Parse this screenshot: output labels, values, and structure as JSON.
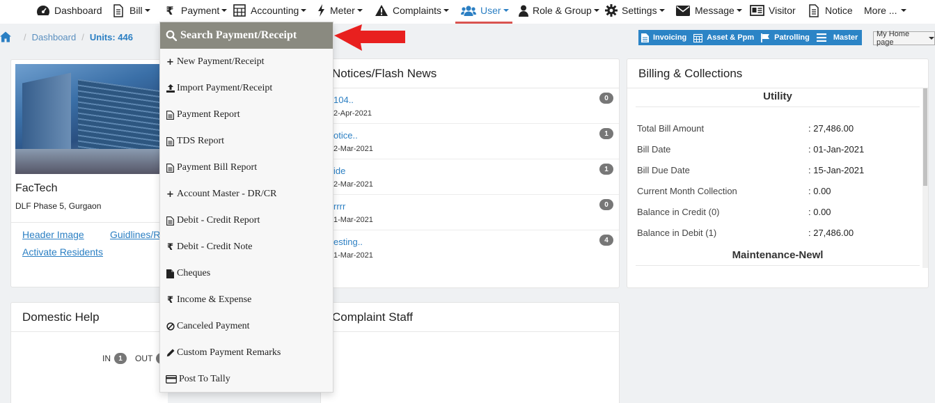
{
  "nav": {
    "items": [
      {
        "label": "Dashboard",
        "icon": "dashboard-icon",
        "caret": false
      },
      {
        "label": "Bill",
        "icon": "bill-icon",
        "caret": true
      },
      {
        "label": "Payment",
        "icon": "rupee-icon",
        "caret": true
      },
      {
        "label": "Accounting",
        "icon": "calculator-icon",
        "caret": true
      },
      {
        "label": "Meter",
        "icon": "bolt-icon",
        "caret": true
      },
      {
        "label": "Complaints",
        "icon": "warning-icon",
        "caret": true
      },
      {
        "label": "User",
        "icon": "users-icon",
        "caret": true,
        "active": true
      },
      {
        "label": "Role & Group",
        "icon": "user-icon",
        "caret": true
      },
      {
        "label": "Settings",
        "icon": "gear-icon",
        "caret": true
      },
      {
        "label": "Message",
        "icon": "envelope-icon",
        "caret": true
      },
      {
        "label": "Visitor",
        "icon": "id-card-icon",
        "caret": false
      },
      {
        "label": "Notice",
        "icon": "document-icon",
        "caret": false
      },
      {
        "label": "More ...",
        "icon": "",
        "caret": true
      }
    ],
    "accent": "#2b7fc3",
    "active_underline": "#d9534f"
  },
  "breadcrumb": {
    "home": "home-icon",
    "dashboard": "Dashboard",
    "units": "Units: 446"
  },
  "quickbar": {
    "invoicing": "Invoicing",
    "asset": "Asset & Ppm",
    "patrolling": "Patrolling",
    "master": "Master",
    "homepage": "My Home page"
  },
  "profile": {
    "name": "FacTech",
    "address": "DLF Phase 5, Gurgaon",
    "link_header_image": "Header Image",
    "link_guidelines": "Guidlines/R",
    "link_activate": "Activate Residents"
  },
  "notices": {
    "title": "Notices/Flash News",
    "items": [
      {
        "title": "104..",
        "date": "2-Apr-2021",
        "count": "0"
      },
      {
        "title": "otice..",
        "date": "2-Mar-2021",
        "count": "1"
      },
      {
        "title": "ide",
        "date": "2-Mar-2021",
        "count": "1"
      },
      {
        "title": "rrrr",
        "date": "1-Mar-2021",
        "count": "0"
      },
      {
        "title": "esting..",
        "date": "1-Mar-2021",
        "count": "4"
      }
    ]
  },
  "billing": {
    "title": "Billing & Collections",
    "section1": "Utility",
    "rows": [
      {
        "label": "Total Bill Amount",
        "value": ": 27,486.00"
      },
      {
        "label": "Bill Date",
        "value": ": 01-Jan-2021"
      },
      {
        "label": "Bill Due Date",
        "value": ": 15-Jan-2021"
      },
      {
        "label": "Current Month Collection",
        "value": ": 0.00"
      },
      {
        "label": "Balance in Credit (0)",
        "value": ": 0.00"
      },
      {
        "label": "Balance in Debit (1)",
        "value": ": 27,486.00"
      }
    ],
    "section2": "Maintenance-Newl"
  },
  "domestic": {
    "title": "Domestic Help",
    "in_label": "IN",
    "in_count": "1",
    "out_label": "OUT"
  },
  "complaint_staff": {
    "title": "Complaint Staff"
  },
  "payment_menu": {
    "header": "Search Payment/Receipt",
    "items": [
      {
        "label": "New Payment/Receipt",
        "icon": "plus-icon"
      },
      {
        "label": "Import Payment/Receipt",
        "icon": "upload-icon"
      },
      {
        "label": "Payment Report",
        "icon": "file-icon"
      },
      {
        "label": "TDS Report",
        "icon": "file-icon"
      },
      {
        "label": "Payment Bill Report",
        "icon": "file-icon"
      },
      {
        "label": "Account Master - DR/CR",
        "icon": "plus-icon"
      },
      {
        "label": "Debit - Credit Report",
        "icon": "file-icon"
      },
      {
        "label": "Debit - Credit Note",
        "icon": "rupee-icon"
      },
      {
        "label": "Cheques",
        "icon": "file-solid-icon"
      },
      {
        "label": "Income & Expense",
        "icon": "rupee-icon"
      },
      {
        "label": "Canceled Payment",
        "icon": "ban-icon"
      },
      {
        "label": "Custom Payment Remarks",
        "icon": "pencil-icon"
      },
      {
        "label": "Post To Tally",
        "icon": "credit-card-icon"
      }
    ]
  },
  "annotation": {
    "arrow_color": "#e8201f"
  }
}
